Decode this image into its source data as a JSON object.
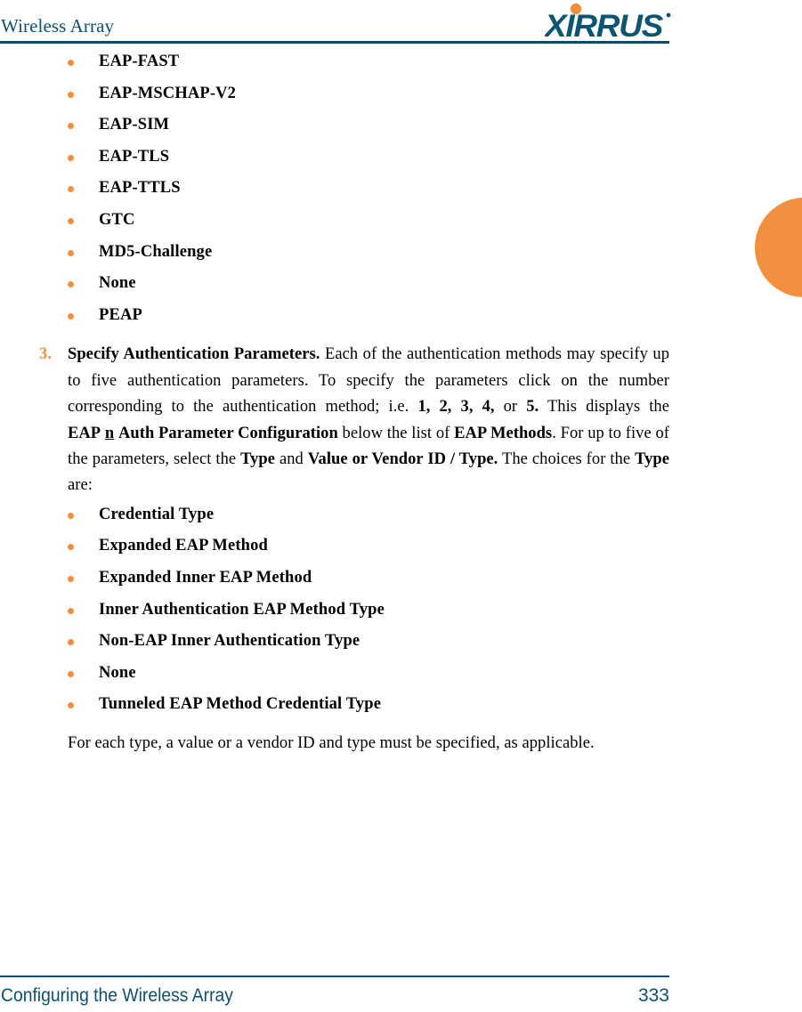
{
  "header": {
    "title": "Wireless Array",
    "logo_text": "XIRRUS",
    "logo_color": "#0b5570",
    "logo_dot_color": "#f3903f",
    "rule_color": "#004f6e"
  },
  "accent": {
    "orange": "#f3903f",
    "teal": "#004f6e",
    "title_teal": "#0d5170"
  },
  "edge_tab": {
    "name": "orange-thumb-tab",
    "color": "#f3903f"
  },
  "eap_methods": {
    "items": [
      "EAP-FAST",
      "EAP-MSCHAP-V2",
      "EAP-SIM",
      "EAP-TLS",
      "EAP-TTLS",
      "GTC",
      "MD5-Challenge",
      "None",
      "PEAP"
    ]
  },
  "step": {
    "number": "3.",
    "heading": "Specify Authentication Parameters.",
    "body_1": " Each of the authentication methods may specify up to five authentication parameters. To specify the parameters click on the number corresponding to the authentication method; i.e. ",
    "numbers": "1, 2, 3, 4,",
    "body_2": " or ",
    "number_5": "5.",
    "body_3": " This displays the ",
    "eap_label": "EAP",
    "eap_n": "n",
    "eap_label_2": "Auth Parameter Configuration",
    "body_4": " below the list of ",
    "eap_methods_label": "EAP Methods",
    "body_5": ". For up to five of the parameters, select the ",
    "type_label": "Type",
    "body_6": " and ",
    "value_label": "Value or Vendor ID / Type.",
    "body_7": " The choices for the ",
    "type_label_2": "Type",
    "body_8": " are:"
  },
  "type_choices": {
    "items": [
      "Credential Type",
      "Expanded EAP Method",
      "Expanded Inner EAP Method",
      "Inner Authentication EAP Method Type",
      "Non-EAP Inner Authentication Type",
      "None",
      "Tunneled EAP Method Credential Type"
    ]
  },
  "closing_paragraph": {
    "text": "For each type, a value or a vendor ID and type must be specified, as applicable."
  },
  "footer": {
    "section": "Configuring the Wireless Array",
    "page_number": "333"
  }
}
